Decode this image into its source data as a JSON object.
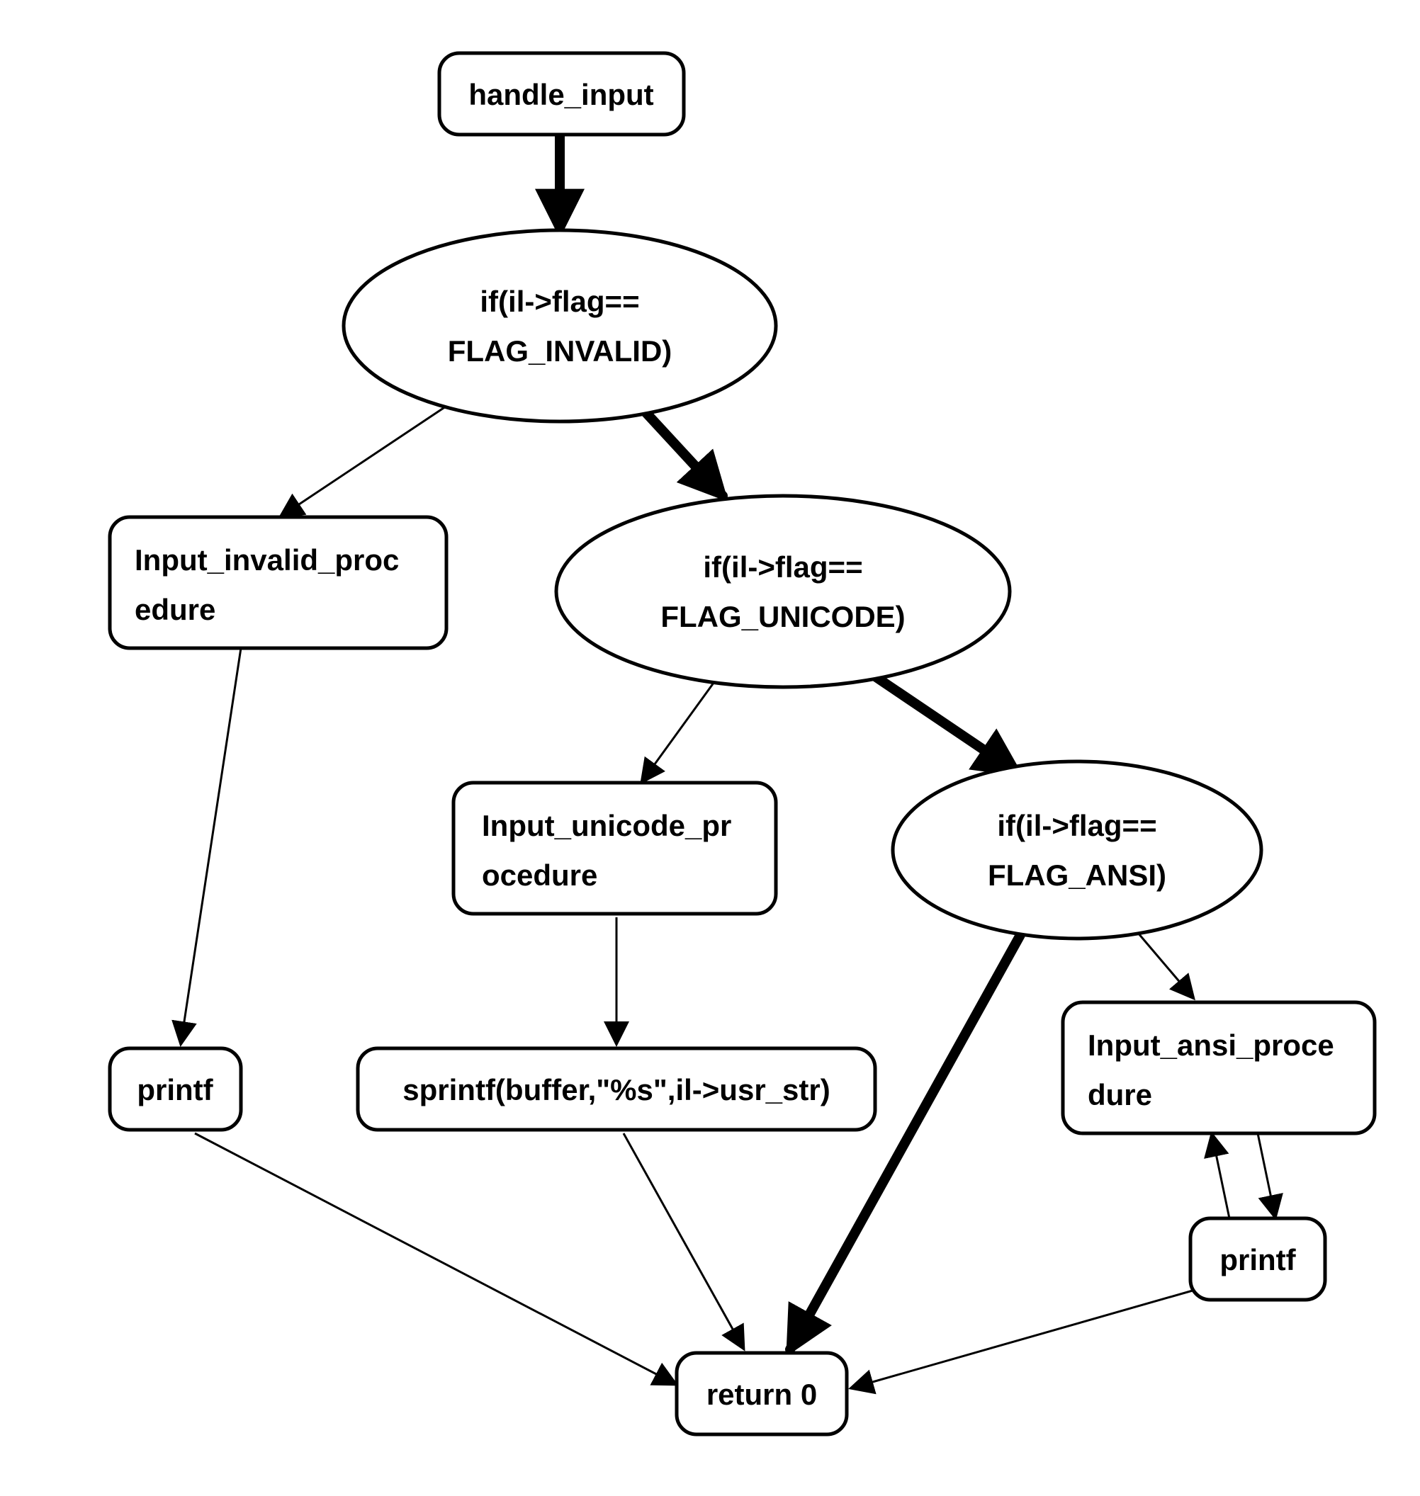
{
  "diagram": {
    "nodes": {
      "handle_input": {
        "label": "handle_input"
      },
      "cond_invalid": {
        "line1": "if(il->flag==",
        "line2": "FLAG_INVALID)"
      },
      "proc_invalid": {
        "line1": "Input_invalid_proc",
        "line2": "edure"
      },
      "cond_unicode": {
        "line1": "if(il->flag==",
        "line2": "FLAG_UNICODE)"
      },
      "proc_unicode": {
        "line1": "Input_unicode_pr",
        "line2": "ocedure"
      },
      "cond_ansi": {
        "line1": "if(il->flag==",
        "line2": "FLAG_ANSI)"
      },
      "proc_ansi": {
        "line1": "Input_ansi_proce",
        "line2": "dure"
      },
      "printf_left": {
        "label": "printf"
      },
      "sprintf": {
        "label": "sprintf(buffer,\"%s\",il->usr_str)"
      },
      "printf_right": {
        "label": "printf"
      },
      "return0": {
        "label": "return 0"
      }
    }
  }
}
